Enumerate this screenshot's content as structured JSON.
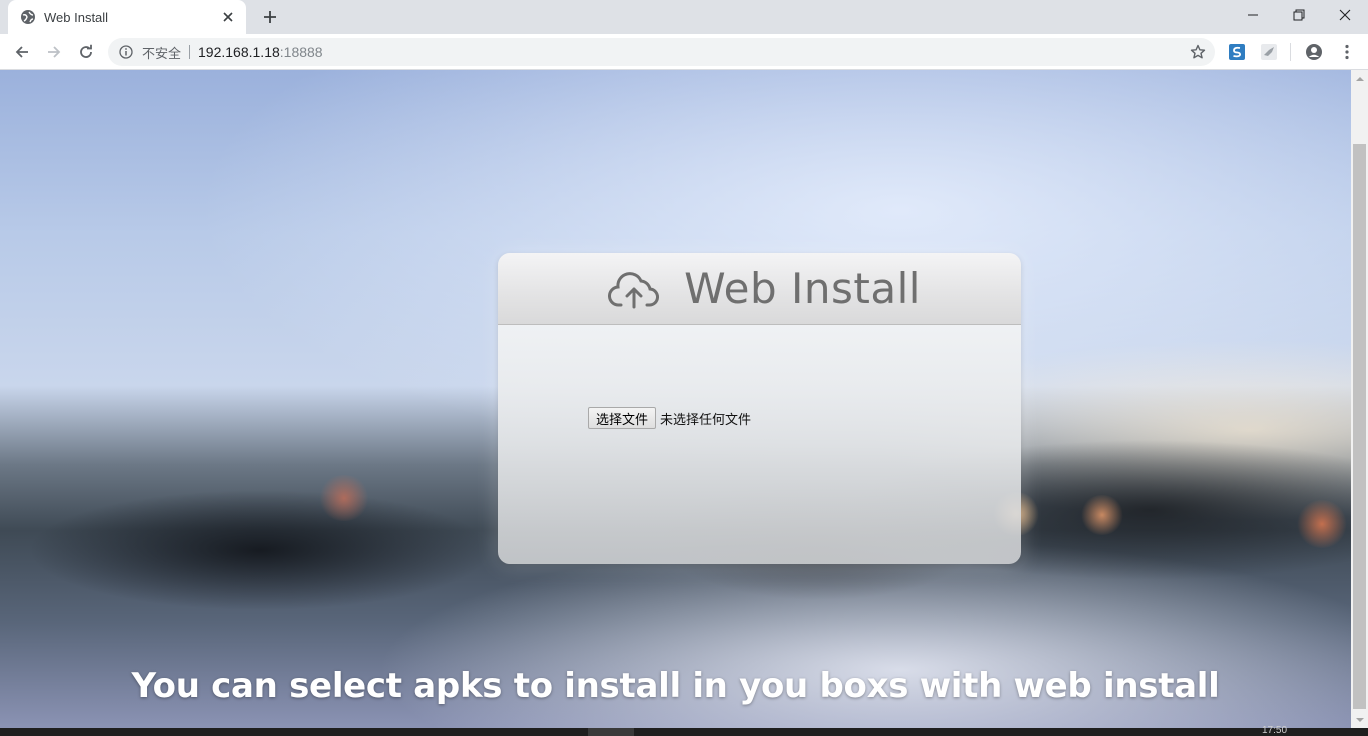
{
  "browser": {
    "tab": {
      "title": "Web Install"
    },
    "address": {
      "security_label": "不安全",
      "host": "192.168.1.18",
      "port": ":18888"
    }
  },
  "icons": {
    "tab_favicon": "globe-icon",
    "tab_close": "close-icon",
    "new_tab": "plus-icon",
    "back": "arrow-left-icon",
    "forward": "arrow-right-icon",
    "reload": "reload-icon",
    "site_info": "info-icon",
    "bookmark": "star-icon",
    "extension_1": "extension-s-icon",
    "extension_2": "extension-bird-icon",
    "profile": "account-icon",
    "menu": "more-vert-icon",
    "card": "cloud-upload-icon"
  },
  "page": {
    "card": {
      "title": "Web Install",
      "file_input": {
        "button_label": "选择文件",
        "status": "未选择任何文件"
      }
    },
    "caption": "You can select apks to install in you boxs with web install"
  },
  "taskbar": {
    "clock": "17:50"
  },
  "colors": {
    "chrome_bg": "#dee1e6",
    "omnibox_bg": "#f1f3f4",
    "title_gray": "#6f6f6f",
    "caption_text": "#ffffff"
  }
}
